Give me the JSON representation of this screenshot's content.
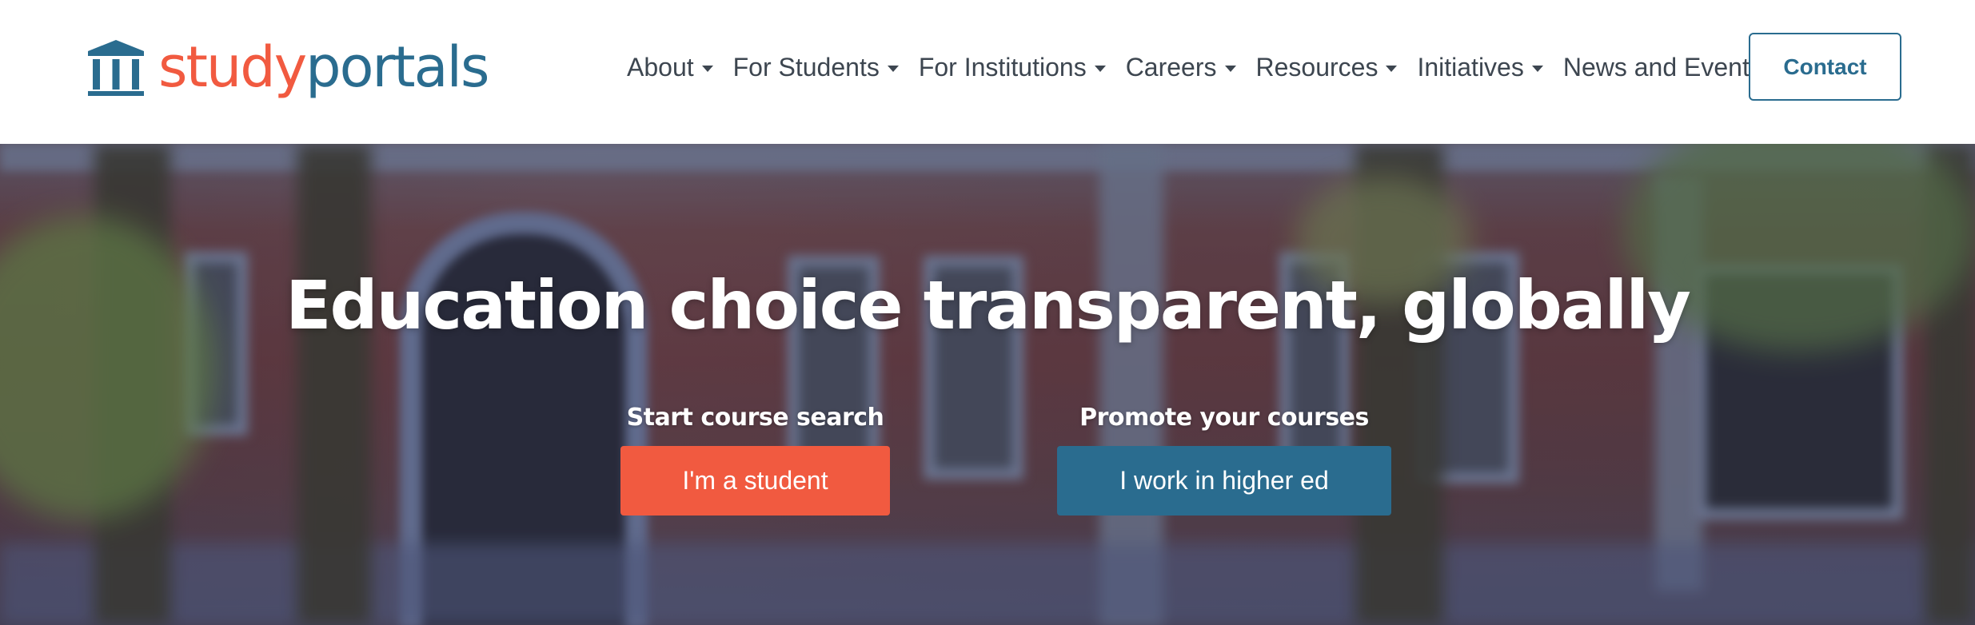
{
  "header": {
    "logo": {
      "study": "study",
      "portals": "portals",
      "study_color": "#f15a40",
      "portals_color": "#2a6c8f",
      "icon": "university-building-icon"
    },
    "nav": [
      {
        "label": "About",
        "icon": "chevron-down-icon"
      },
      {
        "label": "For Students",
        "icon": "chevron-down-icon"
      },
      {
        "label": "For Institutions",
        "icon": "chevron-down-icon"
      },
      {
        "label": "Careers",
        "icon": "chevron-down-icon"
      },
      {
        "label": "Resources",
        "icon": "chevron-down-icon"
      },
      {
        "label": "Initiatives",
        "icon": "chevron-down-icon"
      },
      {
        "label": "News and Events",
        "icon": "chevron-down-icon"
      }
    ],
    "contact_label": "Contact"
  },
  "hero": {
    "title": "Education choice transparent, globally",
    "student_cta": {
      "label": "Start course search",
      "button": "I'm a student",
      "color": "#f15a40"
    },
    "institution_cta": {
      "label": "Promote your courses",
      "button": "I work in higher ed",
      "color": "#2a6c8f"
    }
  }
}
